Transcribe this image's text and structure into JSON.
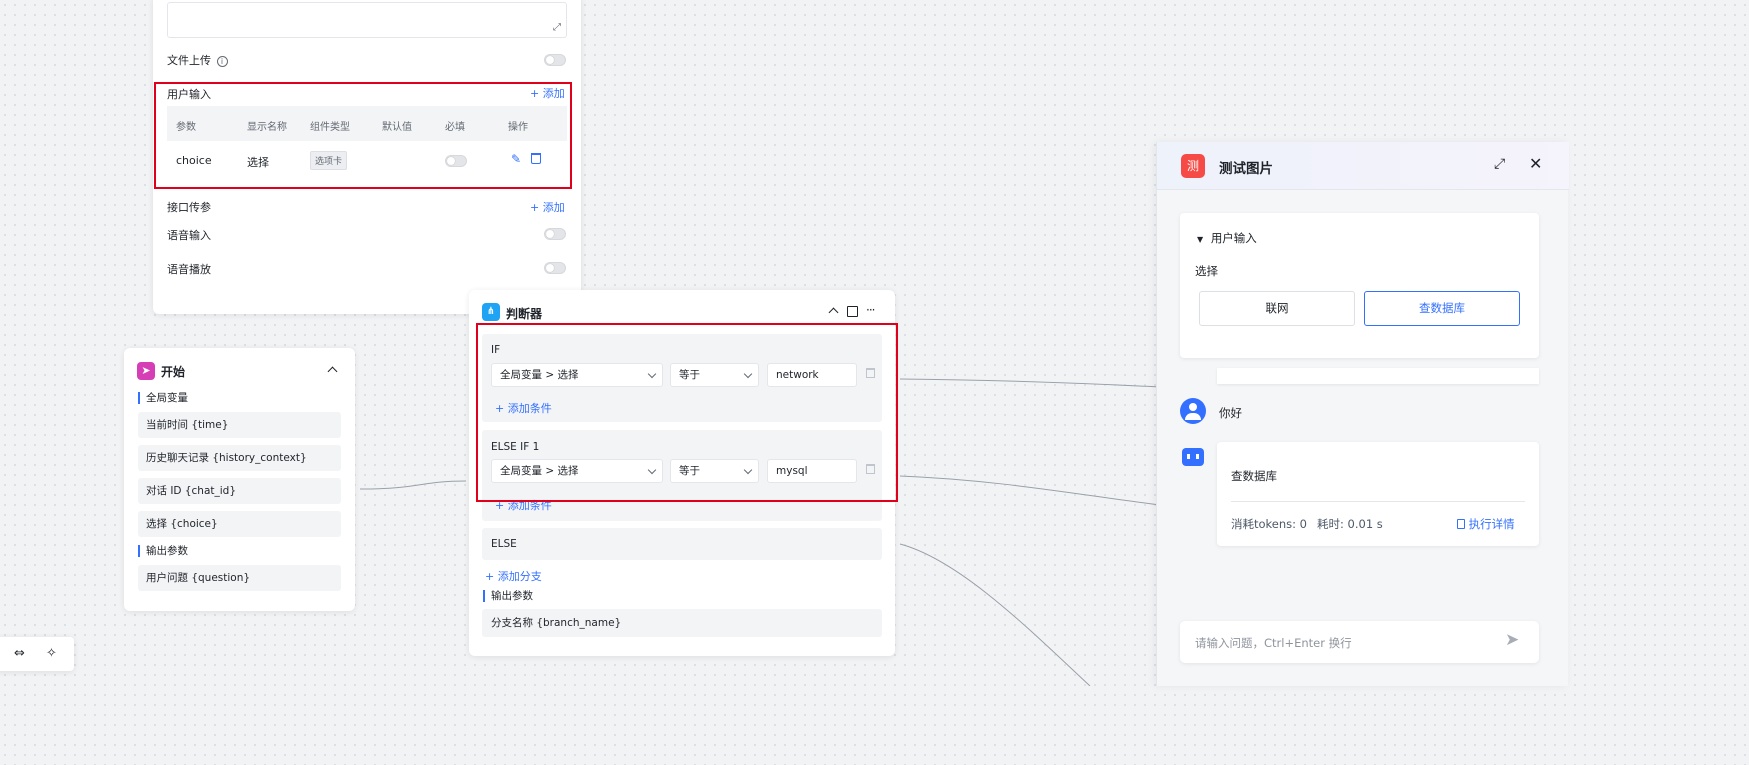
{
  "settings": {
    "file_upload_label": "文件上传",
    "user_input": {
      "title": "用户输入",
      "add_label": "添加",
      "columns": [
        "参数",
        "显示名称",
        "组件类型",
        "默认值",
        "必填",
        "操作"
      ],
      "row": {
        "param": "choice",
        "display_name": "选择",
        "component_type": "选项卡",
        "default": ""
      }
    },
    "api_params": {
      "title": "接口传参",
      "add_label": "添加"
    },
    "voice_input_label": "语音输入",
    "voice_playback_label": "语音播放"
  },
  "start_node": {
    "title": "开始",
    "global_vars_label": "全局变量",
    "global_vars": [
      "当前时间 {time}",
      "历史聊天记录 {history_context}",
      "对话 ID {chat_id}",
      "选择 {choice}"
    ],
    "output_label": "输出参数",
    "outputs": [
      "用户问题 {question}"
    ]
  },
  "judge_node": {
    "title": "判断器",
    "branches": [
      {
        "label": "IF",
        "variable": "全局变量 > 选择",
        "operator": "等于",
        "value": "network",
        "add_condition": "添加条件"
      },
      {
        "label": "ELSE IF 1",
        "variable": "全局变量 > 选择",
        "operator": "等于",
        "value": "mysql",
        "add_condition": "添加条件"
      }
    ],
    "else_label": "ELSE",
    "add_branch": "添加分支",
    "output_label": "输出参数",
    "output": "分支名称 {branch_name}"
  },
  "chat_panel": {
    "avatar_text": "测",
    "title": "测试图片",
    "user_input_title": "用户输入",
    "choice_label": "选择",
    "options": [
      "联网",
      "查数据库"
    ],
    "selected_option": "查数据库",
    "user_message": "你好",
    "bot_reply": "查数据库",
    "tokens_text": "消耗tokens: 0",
    "time_text": "耗时: 0.01 s",
    "details_link": "执行详情",
    "input_placeholder": "请输入问题，Ctrl+Enter 换行"
  },
  "colors": {
    "accent": "#3370ff",
    "highlight": "#e0001b",
    "start_icon": "#d63eb6",
    "judge_icon": "#1fa3f5",
    "chat_avatar": "#f54a45"
  }
}
